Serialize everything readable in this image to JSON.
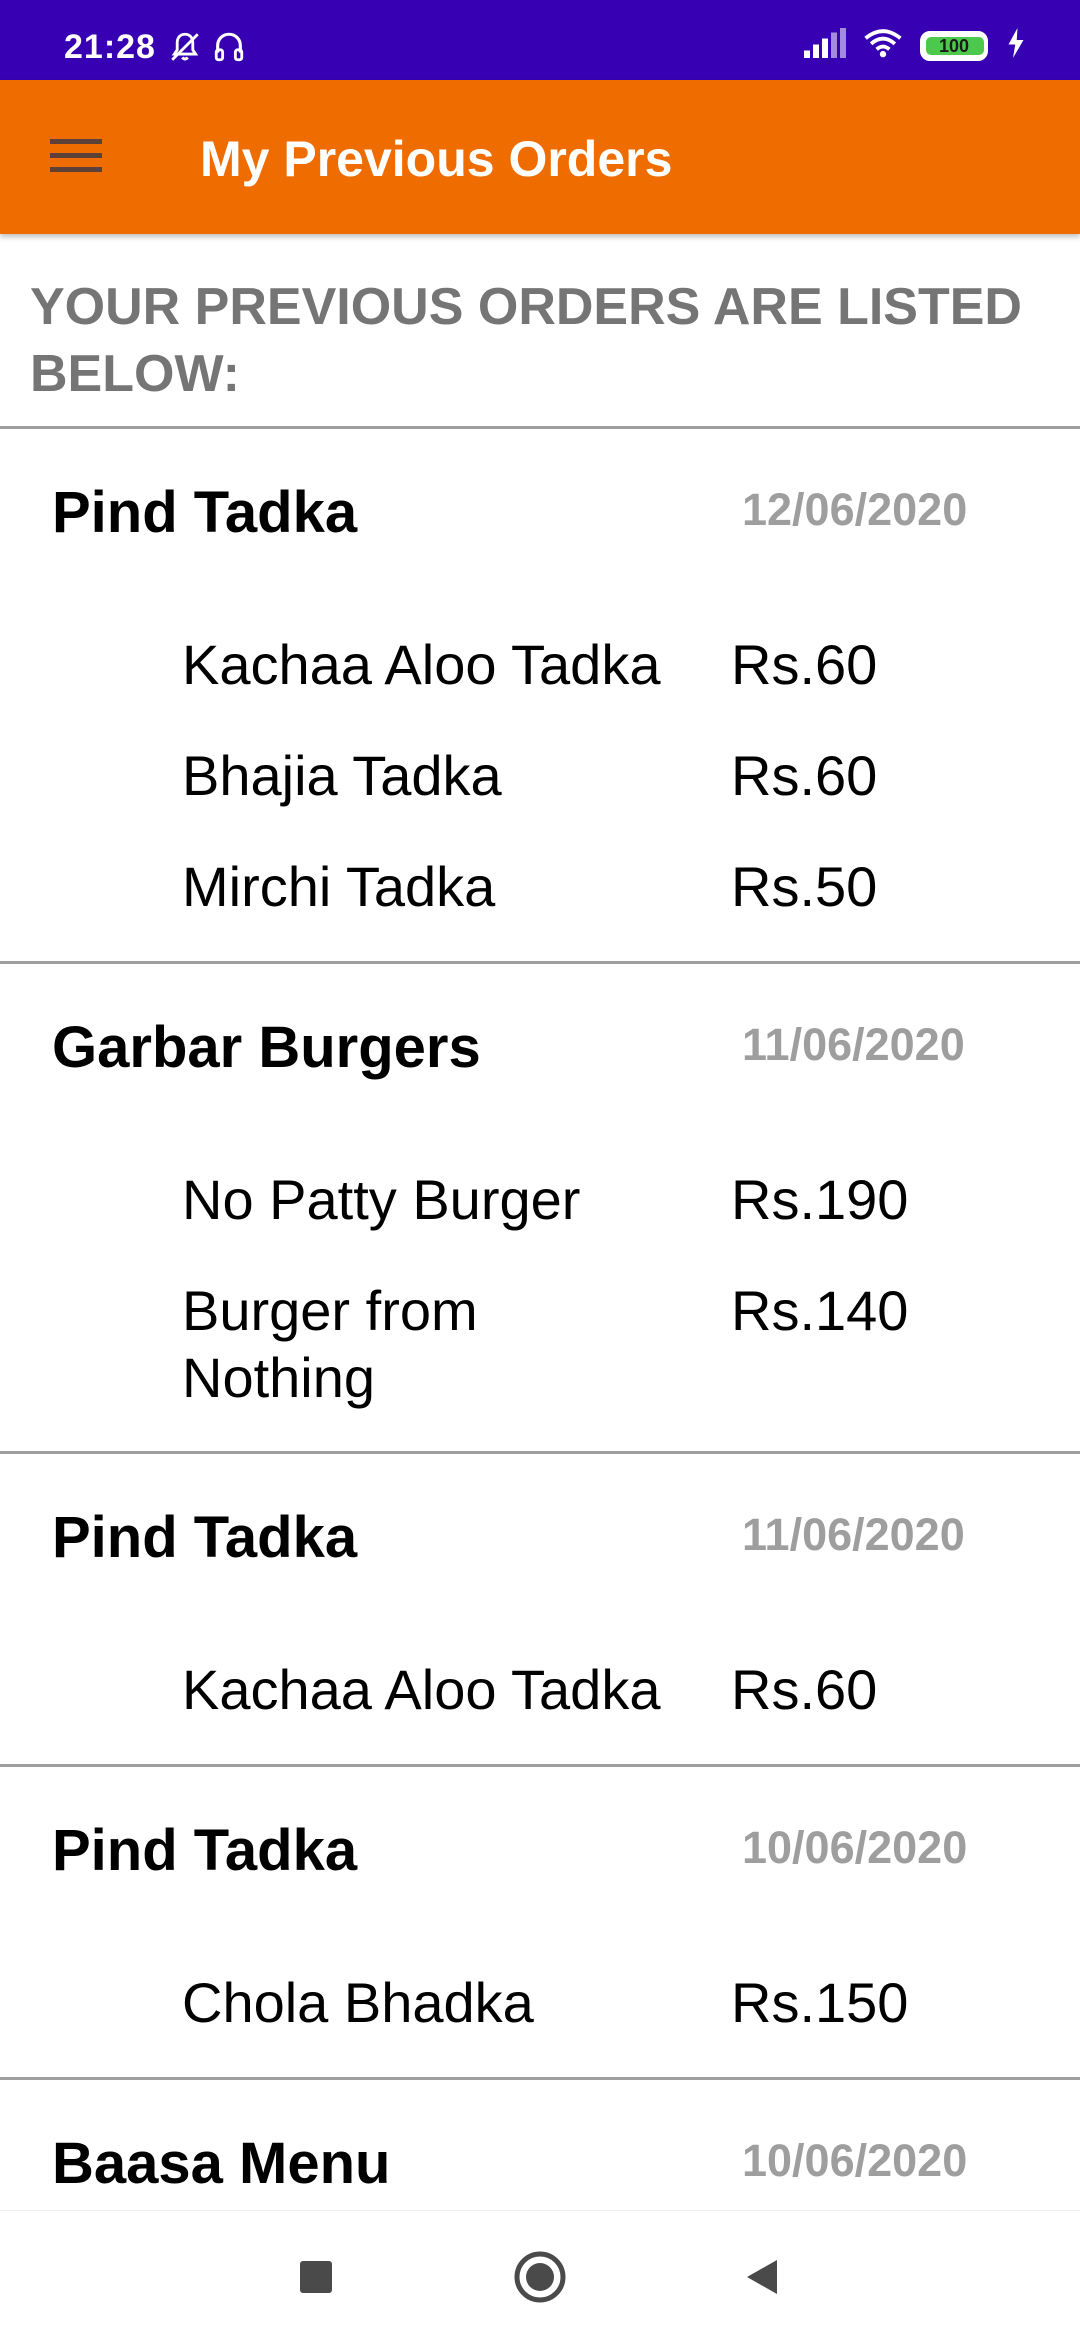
{
  "status_bar": {
    "time": "21:28",
    "battery_level": "100",
    "icons": [
      "mute-notifications-icon",
      "headset-icon",
      "signal-icon",
      "wifi-icon",
      "battery-icon",
      "charging-icon"
    ]
  },
  "app_bar": {
    "title": "My Previous Orders",
    "menu_icon": "hamburger-menu-icon",
    "background_color": "#ef6c00"
  },
  "intro": {
    "text": "YOUR PREVIOUS ORDERS ARE LISTED BELOW:"
  },
  "orders": [
    {
      "restaurant": "Pind Tadka",
      "date": "12/06/2020",
      "items": [
        {
          "name": "Kachaa Aloo Tadka",
          "price": "Rs.60"
        },
        {
          "name": "Bhajia Tadka",
          "price": "Rs.60"
        },
        {
          "name": "Mirchi Tadka",
          "price": "Rs.50"
        }
      ]
    },
    {
      "restaurant": "Garbar Burgers",
      "date": "11/06/2020",
      "items": [
        {
          "name": "No Patty Burger",
          "price": "Rs.190"
        },
        {
          "name": "Burger from Nothing",
          "price": "Rs.140"
        }
      ]
    },
    {
      "restaurant": "Pind Tadka",
      "date": "11/06/2020",
      "items": [
        {
          "name": "Kachaa Aloo Tadka",
          "price": "Rs.60"
        }
      ]
    },
    {
      "restaurant": "Pind Tadka",
      "date": "10/06/2020",
      "items": [
        {
          "name": "Chola Bhadka",
          "price": "Rs.150"
        }
      ]
    },
    {
      "restaurant": "Baasa Menu",
      "date": "10/06/2020",
      "items": []
    }
  ],
  "nav_bar": {
    "buttons": [
      "recents-square-icon",
      "home-circle-icon",
      "back-triangle-icon"
    ]
  }
}
